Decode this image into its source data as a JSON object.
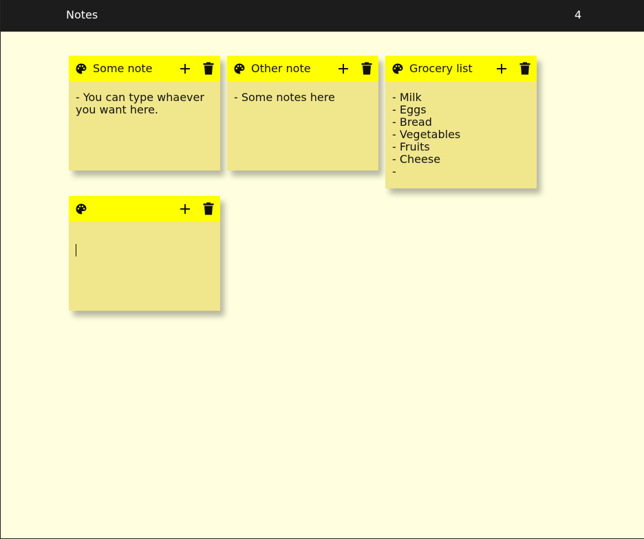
{
  "app": {
    "title": "Notes",
    "note_count": "4"
  },
  "colors": {
    "topbar": "#1c1c1c",
    "background": "#ffffe0",
    "note_header": "#ffff00",
    "note_body": "#f0e68c"
  },
  "icons": {
    "color": "palette-icon",
    "add": "plus-icon",
    "delete": "trash-icon"
  },
  "notes": [
    {
      "title": "Some note",
      "content": "- You can type whaever you want here."
    },
    {
      "title": "Other note",
      "content": "- Some notes here"
    },
    {
      "title": "Grocery list",
      "content": "- Milk\n- Eggs\n- Bread\n- Vegetables\n- Fruits\n- Cheese\n-"
    },
    {
      "title": "",
      "content": ""
    }
  ]
}
